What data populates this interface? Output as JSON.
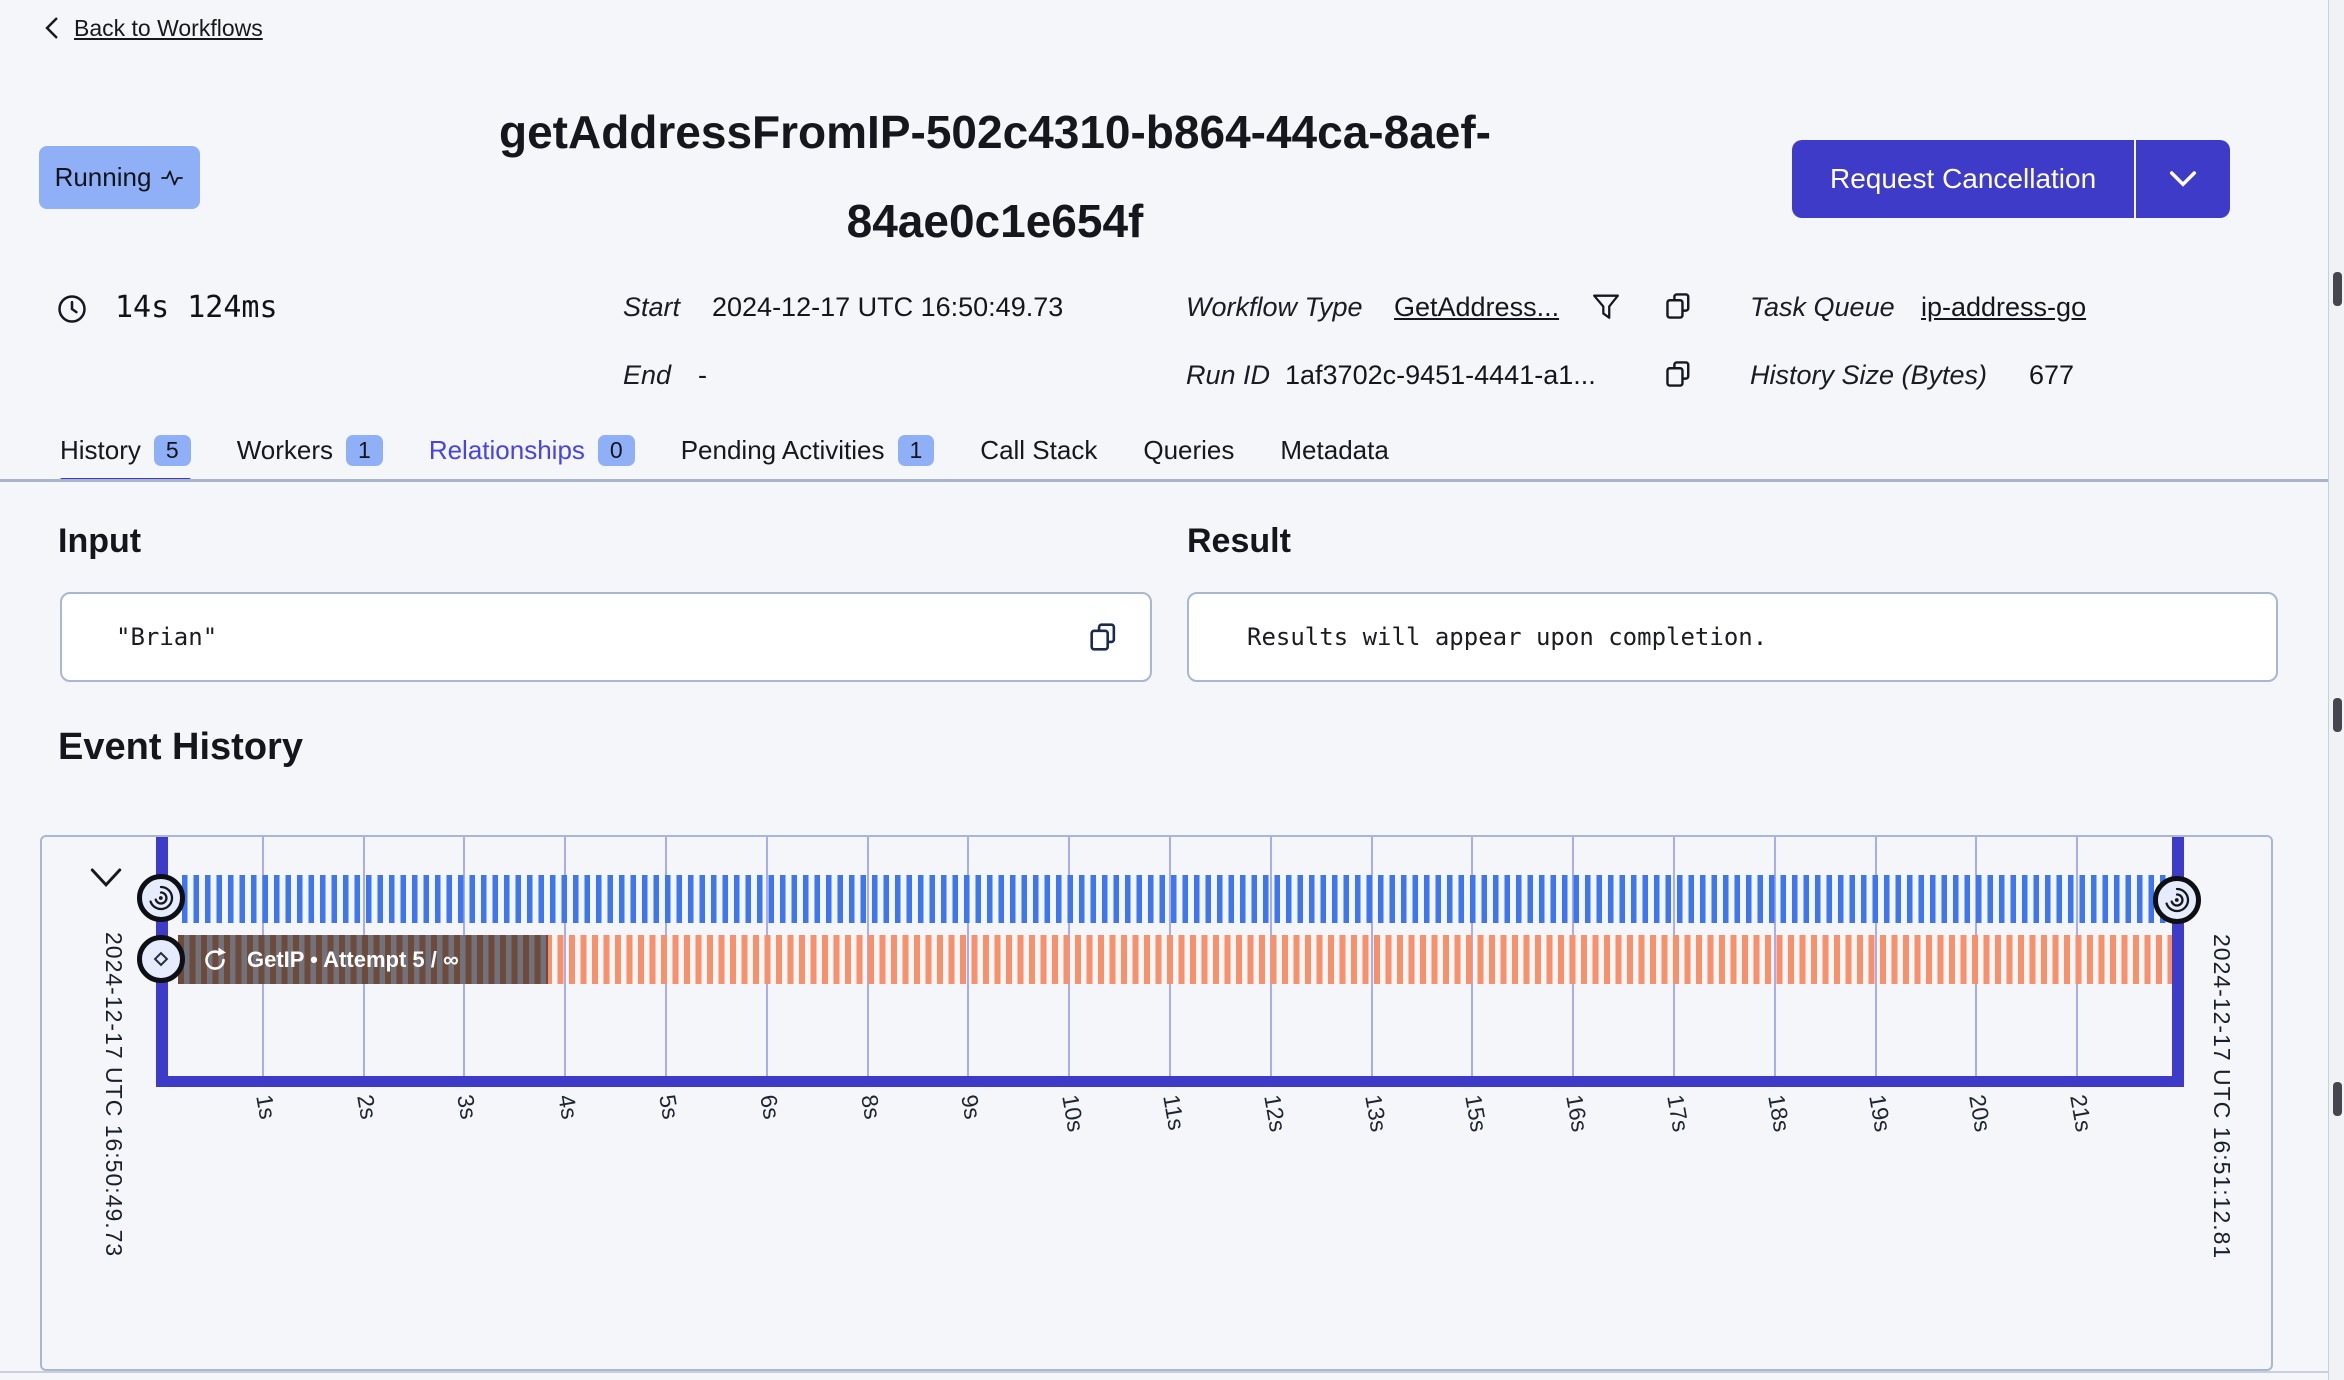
{
  "page": {
    "back_label": "Back to Workflows"
  },
  "header": {
    "status": "Running",
    "title_line1": "getAddressFromIP-502c4310-b864-44ca-8aef-",
    "title_line2": "84ae0c1e654f",
    "cancel_button": "Request Cancellation"
  },
  "stats": {
    "duration": "14s 124ms",
    "start_label": "Start",
    "start_value": "2024-12-17 UTC 16:50:49.73",
    "end_label": "End",
    "end_value": "-",
    "workflow_type_label": "Workflow Type",
    "workflow_type_value": "GetAddress...",
    "run_id_label": "Run ID",
    "run_id_value": "1af3702c-9451-4441-a1...",
    "task_queue_label": "Task Queue",
    "task_queue_value": "ip-address-go",
    "history_size_label": "History Size (Bytes)",
    "history_size_value": "677"
  },
  "tabs": [
    {
      "label": "History",
      "count": "5",
      "active": true
    },
    {
      "label": "Workers",
      "count": "1",
      "active": false
    },
    {
      "label": "Relationships",
      "count": "0",
      "active": false
    },
    {
      "label": "Pending Activities",
      "count": "1",
      "active": false
    },
    {
      "label": "Call Stack",
      "count": null,
      "active": false
    },
    {
      "label": "Queries",
      "count": null,
      "active": false
    },
    {
      "label": "Metadata",
      "count": null,
      "active": false
    }
  ],
  "input_section": {
    "heading": "Input",
    "value": "\"Brian\""
  },
  "result_section": {
    "heading": "Result",
    "value": "Results will appear upon completion."
  },
  "event_history": {
    "heading": "Event History",
    "start_timestamp": "2024-12-17 UTC 16:50:49.73",
    "end_timestamp": "2024-12-17 UTC 16:51:12.81",
    "activity_label": "GetIP • Attempt 5 / ∞",
    "ticks": [
      "1s",
      "2s",
      "3s",
      "4s",
      "5s",
      "6s",
      "8s",
      "9s",
      "10s",
      "11s",
      "12s",
      "13s",
      "15s",
      "16s",
      "17s",
      "18s",
      "19s",
      "20s",
      "21s"
    ]
  },
  "colors": {
    "accent": "#3d3bc7",
    "badge_blue": "#8fb0f7",
    "stripe_blue": "#3d76ed",
    "stripe_orange": "#f8906a",
    "gridline": "#a9adf0",
    "border": "#a9b7d2",
    "link_active": "#4744e0",
    "dark_bar_brown": "#6e4a3b",
    "dark_bar_gray": "#72727c"
  }
}
